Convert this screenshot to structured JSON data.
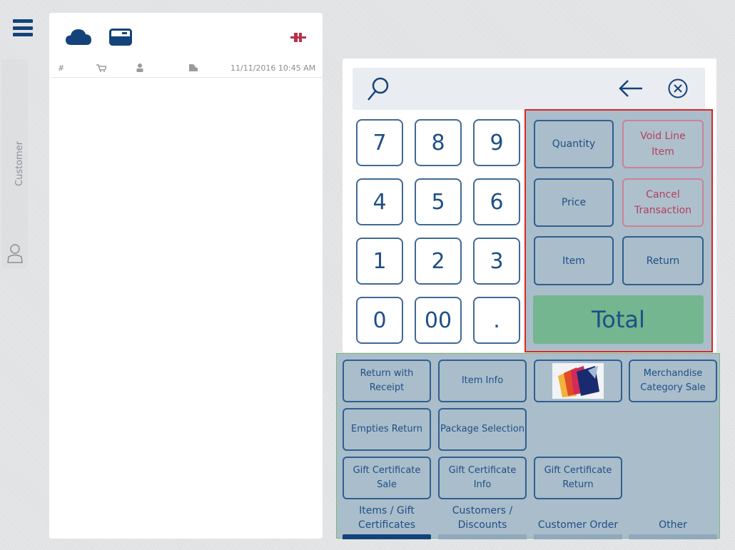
{
  "sidebar": {
    "customer_tab_label": "Customer"
  },
  "transaction": {
    "columns": {
      "number": "#",
      "datetime": "11/11/2016 10:45 AM"
    }
  },
  "keypad": {
    "keys": [
      "7",
      "8",
      "9",
      "4",
      "5",
      "6",
      "1",
      "2",
      "3",
      "0",
      "00",
      "."
    ]
  },
  "functions": {
    "quantity": "Quantity",
    "void_line_item": "Void Line Item",
    "price": "Price",
    "cancel_transaction": "Cancel Transaction",
    "item": "Item",
    "return": "Return",
    "total": "Total"
  },
  "actions": {
    "return_with_receipt": "Return with Receipt",
    "item_info": "Item Info",
    "merchandise_category_sale": "Merchandise Category Sale",
    "empties_return": "Empties Return",
    "package_selection": "Package Selection",
    "gift_certificate_sale": "Gift Certificate Sale",
    "gift_certificate_info": "Gift Certificate Info",
    "gift_certificate_return": "Gift Certificate Return"
  },
  "categories": [
    {
      "label": "Items / Gift Certificates",
      "active": true
    },
    {
      "label": "Customers / Discounts",
      "active": false
    },
    {
      "label": "Customer Order",
      "active": false
    },
    {
      "label": "Other",
      "active": false
    }
  ],
  "colors": {
    "brand_navy": "#14437a",
    "disconnected_red": "#b5334a",
    "total_green": "#73b68f",
    "highlight_red": "#dc2626",
    "highlight_green": "#7cb87c"
  },
  "icons": [
    "menu-icon",
    "cloud-icon",
    "card-reader-icon",
    "plug-disconnected-icon",
    "cart-icon",
    "person-icon",
    "receipt-icon",
    "search-icon",
    "back-arrow-icon",
    "clear-icon",
    "user-icon"
  ]
}
